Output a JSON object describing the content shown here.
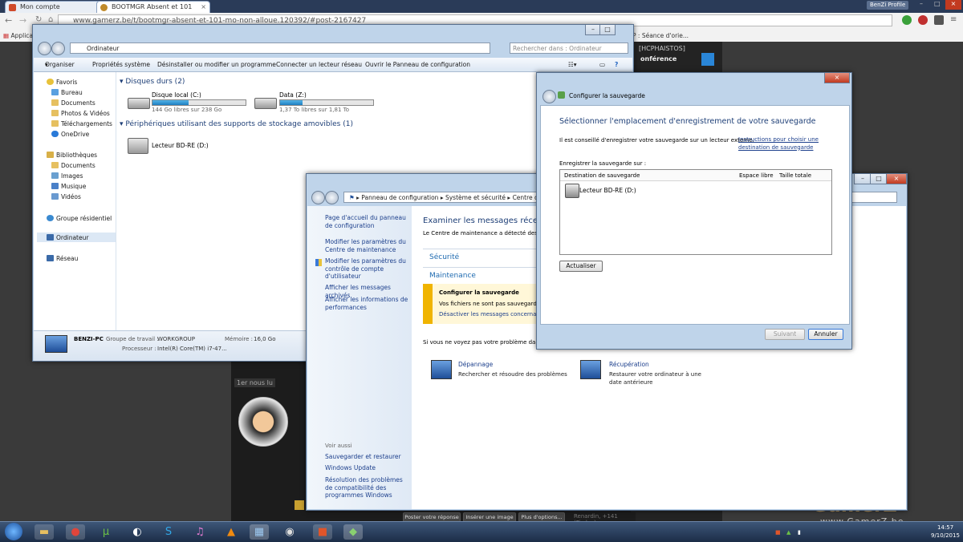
{
  "browser": {
    "tabs": [
      {
        "title": "Mon compte"
      },
      {
        "title": "BOOTMGR Absent et 101"
      }
    ],
    "url": "www.gamerz.be/t/bootmgr-absent-et-101-mo-non-alloue.120392/#post-2167427",
    "apps_label": "Applications",
    "bookmark_partial": "P : Séance d'orie...",
    "profile_label": "BenZi Profile"
  },
  "forum": {
    "user_badge": "[HCPHAISTOS]",
    "side_label": "onférence",
    "post_meta": "1er nous lu",
    "buttons": [
      "Poster votre réponse",
      "Insérer une image",
      "Plus d'options..."
    ],
    "footer_text": "Renardin, +141 (Pizdec)",
    "watermark": "GamerZ",
    "watermark_url": "www.GamerZ.be"
  },
  "explorer": {
    "address": "Ordinateur",
    "search_placeholder": "Rechercher dans : Ordinateur",
    "toolbar": [
      "Organiser",
      "Propriétés système",
      "Désinstaller ou modifier un programme",
      "Connecter un lecteur réseau",
      "Ouvrir le Panneau de configuration"
    ],
    "nav": {
      "favoris": "Favoris",
      "fav_items": [
        "Bureau",
        "Documents",
        "Photos & Vidéos",
        "Téléchargements",
        "OneDrive"
      ],
      "bibliotheques": "Bibliothèques",
      "lib_items": [
        "Documents",
        "Images",
        "Musique",
        "Vidéos"
      ],
      "groupe": "Groupe résidentiel",
      "ordinateur": "Ordinateur",
      "reseau": "Réseau"
    },
    "section_hdd": "Disques durs (2)",
    "section_removable": "Périphériques utilisant des supports de stockage amovibles (1)",
    "drives": [
      {
        "name": "Disque local (C:)",
        "free": "144 Go libres sur 238 Go",
        "used_fraction": 0.39
      },
      {
        "name": "Data (Z:)",
        "free": "1,37 To libres sur 1,81 To",
        "used_fraction": 0.24
      }
    ],
    "removable": {
      "name": "Lecteur BD-RE (D:)"
    },
    "details": {
      "pc_name": "BENZI-PC",
      "workgroup_label": "Groupe de travail :",
      "workgroup": "WORKGROUP",
      "memory_label": "Mémoire :",
      "memory": "16,0 Go",
      "cpu_label": "Processeur :",
      "cpu": "Intel(R) Core(TM) i7-47..."
    }
  },
  "control_panel": {
    "breadcrumb": [
      "Panneau de configuration",
      "Système et sécurité",
      "Centre de ma"
    ],
    "sidebar_links": [
      "Page d'accueil du panneau de configuration",
      "Modifier les paramètres du Centre de maintenance",
      "Modifier les paramètres du contrôle de compte d'utilisateur",
      "Afficher les messages archivés",
      "Afficher les informations de performances"
    ],
    "see_also_title": "Voir aussi",
    "see_also": [
      "Sauvegarder et restaurer",
      "Windows Update",
      "Résolution des problèmes de compatibilité des programmes Windows"
    ],
    "heading": "Examiner les messages récents e",
    "subtext": "Le Centre de maintenance a détecté des pr",
    "security": "Sécurité",
    "maintenance": "Maintenance",
    "alert_title": "Configurer la sauvegarde",
    "alert_text": "Vos fichiers ne sont pas sauvegardés",
    "alert_link": "Désactiver les messages concernant",
    "bottom_text": "Si vous ne voyez pas votre problème dans l",
    "depannage_title": "Dépannage",
    "depannage_text": "Rechercher et résoudre des problèmes",
    "recuperation_title": "Récupération",
    "recuperation_text": "Restaurer votre ordinateur à une date antérieure"
  },
  "backup_dialog": {
    "title": "Configurer la sauvegarde",
    "heading": "Sélectionner l'emplacement d'enregistrement de votre sauvegarde",
    "desc": "Il est conseillé d'enregistrer votre sauvegarde sur un lecteur externe.",
    "desc_link": "Instructions pour choisir une destination de sauvegarde",
    "save_on": "Enregistrer la sauvegarde sur :",
    "columns": [
      "Destination de sauvegarde",
      "Espace libre",
      "Taille totale"
    ],
    "rows": [
      {
        "destination": "Lecteur BD-RE (D:)"
      }
    ],
    "refresh": "Actualiser",
    "next": "Suivant",
    "cancel": "Annuler"
  },
  "taskbar": {
    "apps": [
      "start-orb",
      "explorer",
      "chrome",
      "utorrent",
      "media",
      "skype",
      "itunes",
      "vlc",
      "control-panel",
      "steam",
      "office",
      "backup"
    ],
    "lang": "FR",
    "time": "14:57",
    "date": "9/10/2015"
  }
}
